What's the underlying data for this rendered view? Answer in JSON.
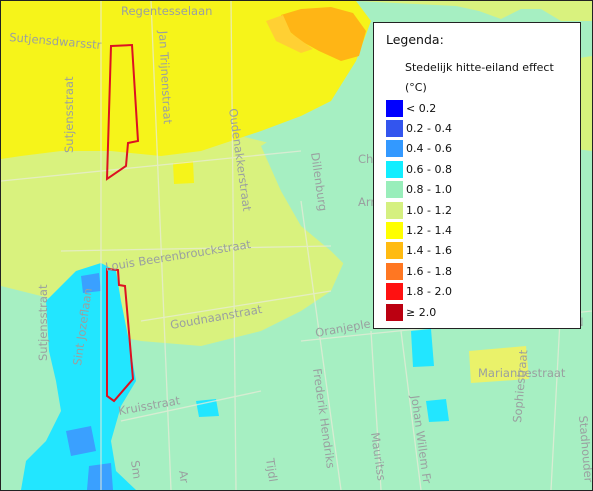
{
  "map": {
    "streets": [
      {
        "id": "regentesselaan",
        "name": "Regentesselaan"
      },
      {
        "id": "sutjensdwarsstraat",
        "name": "Sutjensdwarsstr"
      },
      {
        "id": "sutjensstraat-north",
        "name": "Sutjensstraat"
      },
      {
        "id": "jan-trijnenstraat",
        "name": "Jan Trijnenstraat"
      },
      {
        "id": "oudenakkerstraat",
        "name": "Oudenakkerstraat"
      },
      {
        "id": "dillenburg",
        "name": "Dillenburg"
      },
      {
        "id": "louis-beerenbrouckstraat",
        "name": "Louis Beerenbrouckstraat"
      },
      {
        "id": "goudnaanstraat",
        "name": "Goudnaanstraat"
      },
      {
        "id": "oranjeplein",
        "name": "Oranjeple"
      },
      {
        "id": "sutjensstraat-south",
        "name": "Sutjensstraat"
      },
      {
        "id": "sint-jozeflaan",
        "name": "Sint Jozeflaan"
      },
      {
        "id": "kruisstraat",
        "name": "Kruisstraat"
      },
      {
        "id": "frederik-hendriks",
        "name": "Frederik Hendriks"
      },
      {
        "id": "johan-willem-fr",
        "name": "Johan Willem Fr"
      },
      {
        "id": "mauritsstraat",
        "name": "Mauritss"
      },
      {
        "id": "mariannestraat",
        "name": "Mariannestraat"
      },
      {
        "id": "sophiestraat",
        "name": "Sophiestraat"
      },
      {
        "id": "stadhouderslaan",
        "name": "Stadhouder"
      },
      {
        "id": "tijdl",
        "name": "Tijdl"
      },
      {
        "id": "arn-east",
        "name": "Arn"
      },
      {
        "id": "ch-east",
        "name": "Ch"
      },
      {
        "id": "n-east",
        "name": "N"
      },
      {
        "id": "ar-south",
        "name": "Ar"
      },
      {
        "id": "sm-south",
        "name": "Sm"
      }
    ],
    "outline_color": "#dd1122"
  },
  "legend": {
    "title": "Legenda:",
    "subtitle": "Stedelijk hitte-eiland effect",
    "unit": "(°C)",
    "items": [
      {
        "label": "< 0.2",
        "color": "#0000ff"
      },
      {
        "label": "0.2 - 0.4",
        "color": "#3355ee"
      },
      {
        "label": "0.4 - 0.6",
        "color": "#3399ff"
      },
      {
        "label": "0.6 - 0.8",
        "color": "#11eeff"
      },
      {
        "label": "0.8 - 1.0",
        "color": "#99eebb"
      },
      {
        "label": "1.0 - 1.2",
        "color": "#d5f080"
      },
      {
        "label": "1.2 - 1.4",
        "color": "#ffff00"
      },
      {
        "label": "1.4 - 1.6",
        "color": "#ffbb11"
      },
      {
        "label": "1.6 - 1.8",
        "color": "#ff7722"
      },
      {
        "label": "1.8 - 2.0",
        "color": "#ff1111"
      },
      {
        "label": "≥ 2.0",
        "color": "#bb0011"
      }
    ]
  }
}
